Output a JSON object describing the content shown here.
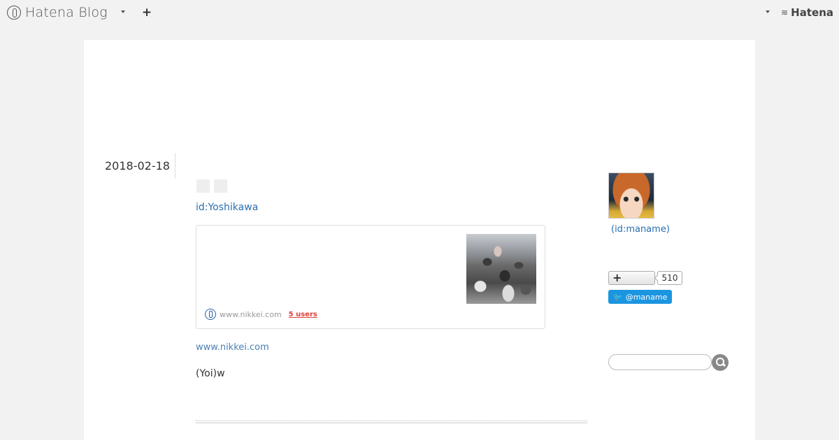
{
  "header": {
    "logo_text": "Hatena Blog",
    "logo_icon": "hatena-blog-logo-icon",
    "add_icon_glyph": "+",
    "right_logo_text": "Hatena",
    "right_logo_glyph": "≋"
  },
  "entry": {
    "date": "2018-02-18",
    "author_link": "id:Yoshikawa",
    "embed": {
      "domain": "www.nikkei.com",
      "users": "5 users"
    },
    "source_link": "www.nikkei.com",
    "body_text": "(Yoi)w"
  },
  "sidebar": {
    "profile_id": "(id:maname)",
    "star_glyph": "+",
    "subscriber_count": "510",
    "twitter_label": "@maname",
    "twitter_glyph": "🐦",
    "search_placeholder": ""
  },
  "colors": {
    "link": "#2a6eb0",
    "users_badge": "#e0413a",
    "twitter": "#1b95e0",
    "background": "#f2f2f2"
  }
}
